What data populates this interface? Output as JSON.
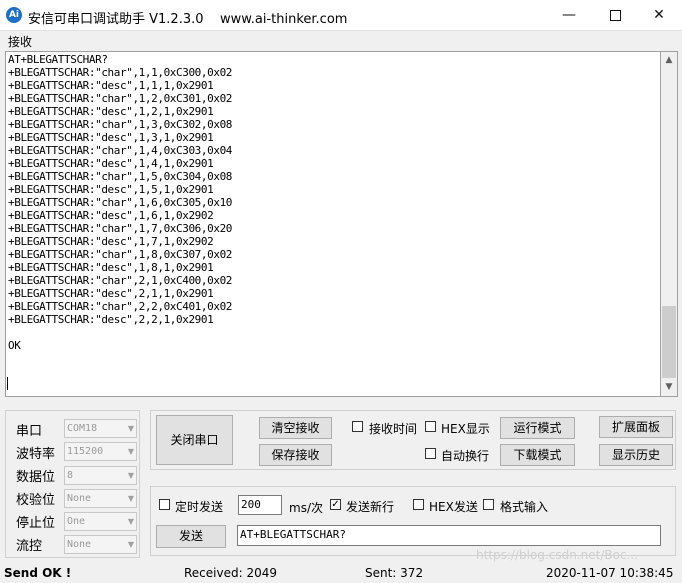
{
  "titlebar": {
    "icon_text": "Ai",
    "title": "安信可串口调试助手 V1.2.3.0    www.ai-thinker.com",
    "minimize": "—",
    "close": "✕"
  },
  "receive": {
    "label": "接收",
    "lines": [
      "AT+BLEGATTSCHAR?",
      "+BLEGATTSCHAR:\"char\",1,1,0xC300,0x02",
      "+BLEGATTSCHAR:\"desc\",1,1,1,0x2901",
      "+BLEGATTSCHAR:\"char\",1,2,0xC301,0x02",
      "+BLEGATTSCHAR:\"desc\",1,2,1,0x2901",
      "+BLEGATTSCHAR:\"char\",1,3,0xC302,0x08",
      "+BLEGATTSCHAR:\"desc\",1,3,1,0x2901",
      "+BLEGATTSCHAR:\"char\",1,4,0xC303,0x04",
      "+BLEGATTSCHAR:\"desc\",1,4,1,0x2901",
      "+BLEGATTSCHAR:\"char\",1,5,0xC304,0x08",
      "+BLEGATTSCHAR:\"desc\",1,5,1,0x2901",
      "+BLEGATTSCHAR:\"char\",1,6,0xC305,0x10",
      "+BLEGATTSCHAR:\"desc\",1,6,1,0x2902",
      "+BLEGATTSCHAR:\"char\",1,7,0xC306,0x20",
      "+BLEGATTSCHAR:\"desc\",1,7,1,0x2902",
      "+BLEGATTSCHAR:\"char\",1,8,0xC307,0x02",
      "+BLEGATTSCHAR:\"desc\",1,8,1,0x2901",
      "+BLEGATTSCHAR:\"char\",2,1,0xC400,0x02",
      "+BLEGATTSCHAR:\"desc\",2,1,1,0x2901",
      "+BLEGATTSCHAR:\"char\",2,2,0xC401,0x02",
      "+BLEGATTSCHAR:\"desc\",2,2,1,0x2901",
      "",
      "OK"
    ]
  },
  "serial": {
    "port_label": "串口",
    "port_value": "COM18",
    "baud_label": "波特率",
    "baud_value": "115200",
    "databits_label": "数据位",
    "databits_value": "8",
    "parity_label": "校验位",
    "parity_value": "None",
    "stopbits_label": "停止位",
    "stopbits_value": "One",
    "flow_label": "流控",
    "flow_value": "None"
  },
  "controls": {
    "close_port": "关闭串口",
    "clear_recv": "清空接收",
    "save_recv": "保存接收",
    "recv_time": "接收时间",
    "hex_display": "HEX显示",
    "auto_wrap": "自动换行",
    "run_mode": "运行模式",
    "download_mode": "下载模式",
    "expand_panel": "扩展面板",
    "show_history": "显示历史"
  },
  "send": {
    "timed_send": "定时发送",
    "interval_value": "200",
    "interval_unit": "ms/次",
    "newline_label": "发送新行",
    "newline_checked": "✓",
    "hex_send": "HEX发送",
    "format_input": "格式输入",
    "send_button": "发送",
    "send_text": "AT+BLEGATTSCHAR?"
  },
  "status": {
    "send_ok": "Send OK !",
    "received": "Received: 2049",
    "sent": "Sent: 372",
    "datetime": "2020-11-07 10:38:45"
  },
  "watermark": "https://blog.csdn.net/Boc..."
}
